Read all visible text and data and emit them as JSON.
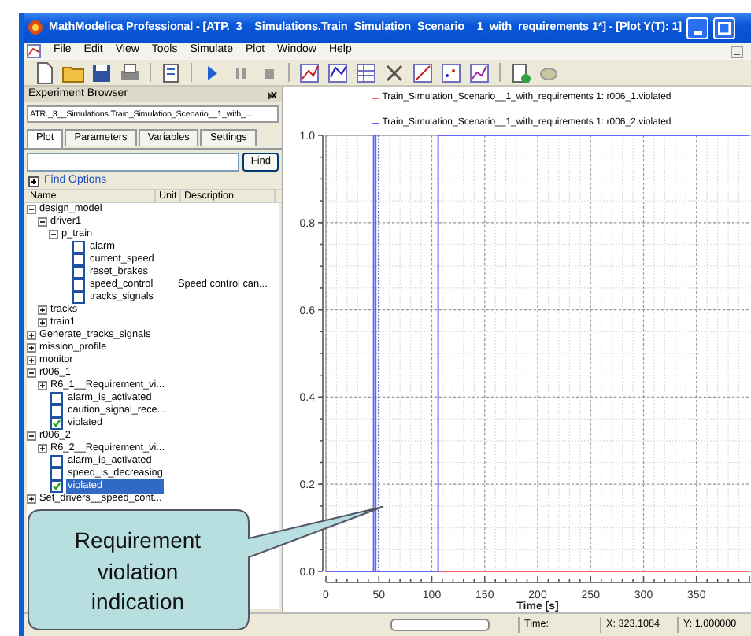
{
  "window": {
    "title": "MathModelica Professional  - [ATP._3__Simulations.Train_Simulation_Scenario__1_with_requirements 1*] - [Plot Y(T): 1]"
  },
  "menu": [
    "File",
    "Edit",
    "View",
    "Tools",
    "Simulate",
    "Plot",
    "Window",
    "Help"
  ],
  "experiment_browser": {
    "title": "Experiment Browser",
    "model": "ATR._3__Simulations.Train_Simulation_Scenario__1_with_...",
    "tabs": [
      {
        "label": "Plot",
        "selected": true
      },
      {
        "label": "Parameters",
        "selected": false
      },
      {
        "label": "Variables",
        "selected": false
      },
      {
        "label": "Settings",
        "selected": false
      }
    ],
    "find_button": "Find",
    "find_options": {
      "label": "Find Options",
      "expanded": false
    },
    "columns": [
      "Name",
      "Unit",
      "Description"
    ],
    "tree": [
      {
        "label": "design_model",
        "kind": "group",
        "expanded": true,
        "children": [
          {
            "label": "driver1",
            "kind": "group",
            "expanded": true,
            "children": [
              {
                "label": "p_train",
                "kind": "group",
                "expanded": true,
                "children": [
                  {
                    "label": "alarm",
                    "kind": "variable",
                    "checked": false,
                    "selected": false
                  },
                  {
                    "label": "current_speed",
                    "kind": "variable",
                    "checked": false,
                    "selected": false
                  },
                  {
                    "label": "reset_brakes",
                    "kind": "variable",
                    "checked": false,
                    "selected": false
                  },
                  {
                    "label": "speed_control",
                    "kind": "variable",
                    "checked": false,
                    "selected": false,
                    "description": "Speed control can..."
                  },
                  {
                    "label": "tracks_signals",
                    "kind": "variable",
                    "checked": false,
                    "selected": false
                  }
                ]
              }
            ]
          },
          {
            "label": "tracks",
            "kind": "group",
            "expanded": false
          },
          {
            "label": "train1",
            "kind": "group",
            "expanded": false
          }
        ]
      },
      {
        "label": "Generate_tracks_signals",
        "kind": "group",
        "expanded": false
      },
      {
        "label": "mission_profile",
        "kind": "group",
        "expanded": false
      },
      {
        "label": "monitor",
        "kind": "group",
        "expanded": false
      },
      {
        "label": "r006_1",
        "kind": "group",
        "expanded": true,
        "children": [
          {
            "label": "R6_1__Requirement_vi...",
            "kind": "group",
            "expanded": false
          },
          {
            "label": "alarm_is_activated",
            "kind": "variable",
            "checked": false,
            "selected": false
          },
          {
            "label": "caution_signal_rece...",
            "kind": "variable",
            "checked": false,
            "selected": false
          },
          {
            "label": "violated",
            "kind": "variable",
            "checked": true,
            "selected": false
          }
        ]
      },
      {
        "label": "r006_2",
        "kind": "group",
        "expanded": true,
        "children": [
          {
            "label": "R6_2__Requirement_vi...",
            "kind": "group",
            "expanded": false
          },
          {
            "label": "alarm_is_activated",
            "kind": "variable",
            "checked": false,
            "selected": false
          },
          {
            "label": "speed_is_decreasing",
            "kind": "variable",
            "checked": false,
            "selected": false
          },
          {
            "label": "violated",
            "kind": "variable",
            "checked": true,
            "selected": true
          }
        ]
      },
      {
        "label": "Set_drivers__speed_cont...",
        "kind": "group",
        "expanded": false
      }
    ]
  },
  "plot": {
    "chart_data": {
      "type": "line",
      "xlabel": "Time [s]",
      "x": [
        0,
        45,
        45,
        47,
        47,
        106,
        106,
        400
      ],
      "series": [
        {
          "name": "Train_Simulation_Scenario__1_with_requirements 1: r006_1.violated",
          "color": "#ff6666",
          "values": [
            null,
            null,
            null,
            null,
            null,
            0,
            0,
            0
          ]
        },
        {
          "name": "Train_Simulation_Scenario__1_with_requirements 1: r006_2.violated",
          "color": "#6666ff",
          "values": [
            0,
            0,
            1,
            1,
            0,
            0,
            1,
            1
          ]
        }
      ],
      "xlim": [
        0,
        400
      ],
      "ylim": [
        0,
        1
      ],
      "xticks": [
        0,
        50,
        100,
        150,
        200,
        250,
        300,
        350
      ],
      "grid": true,
      "ref_lines": [
        {
          "axis": "x",
          "value": 50,
          "color": "#1010a0"
        }
      ],
      "yticks": [
        {
          "value": 0,
          "label": "0.0"
        },
        {
          "value": 0.2,
          "label": "0.2"
        },
        {
          "value": 0.4,
          "label": "0.4"
        },
        {
          "value": 0.6,
          "label": "0.6"
        },
        {
          "value": 0.8,
          "label": "0.8"
        },
        {
          "value": 1,
          "label": "1.0"
        }
      ]
    }
  },
  "callout": {
    "text": "Requirement violation indication"
  },
  "status_bar": {
    "time_label": "Time:",
    "x": "X: 323.1084",
    "y": "Y: 1.000000"
  }
}
